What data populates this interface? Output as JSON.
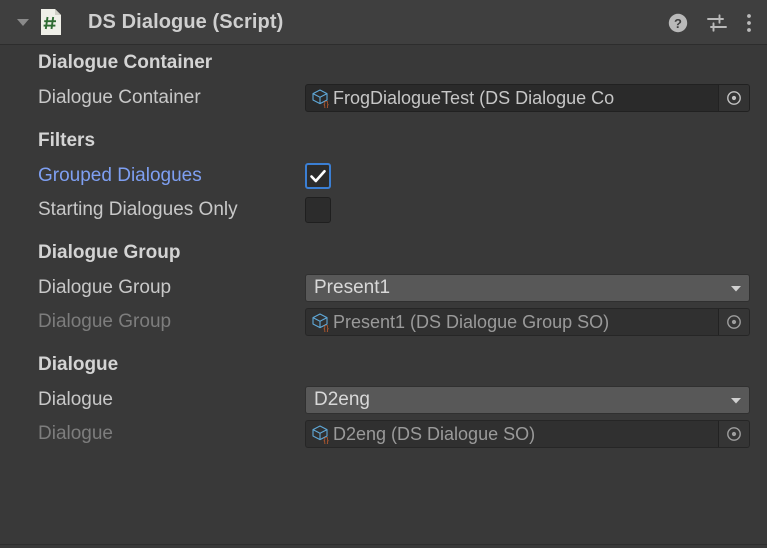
{
  "component": {
    "title": "DS Dialogue (Script)",
    "foldout_icon": "triangle-down-icon",
    "script_icon": "csharp-script-icon",
    "help_icon": "help-icon",
    "preset_icon": "preset-settings-icon",
    "menu_icon": "more-options-icon"
  },
  "colors": {
    "panel_bg": "#393939",
    "header_bg": "#3f3f3f",
    "accent_blue": "#7e9ff2",
    "checkbox_border": "#3b7fd4",
    "object_field_bg": "#2a2a2a",
    "dropdown_bg": "#585858",
    "label": "#c8c8c8",
    "label_disabled": "#7d7d7d"
  },
  "sections": [
    {
      "header": "Dialogue Container",
      "rows": [
        {
          "type": "object",
          "label": "Dialogue Container",
          "value": "FrogDialogueTest (DS Dialogue Co",
          "icon": "scriptable-object-icon",
          "picker_icon": "object-picker-icon",
          "disabled": false
        }
      ]
    },
    {
      "header": "Filters",
      "rows": [
        {
          "type": "checkbox",
          "label": "Grouped Dialogues",
          "checked": true,
          "label_highlight": true,
          "disabled": false
        },
        {
          "type": "checkbox",
          "label": "Starting Dialogues Only",
          "checked": false,
          "label_highlight": false,
          "disabled": false
        }
      ]
    },
    {
      "header": "Dialogue Group",
      "rows": [
        {
          "type": "dropdown",
          "label": "Dialogue Group",
          "value": "Present1",
          "arrow_icon": "chevron-down-icon",
          "disabled": false
        },
        {
          "type": "object",
          "label": "Dialogue Group",
          "value": "Present1 (DS Dialogue Group SO)",
          "icon": "scriptable-object-icon",
          "picker_icon": "object-picker-icon",
          "disabled": true
        }
      ]
    },
    {
      "header": "Dialogue",
      "rows": [
        {
          "type": "dropdown",
          "label": "Dialogue",
          "value": "D2eng",
          "arrow_icon": "chevron-down-icon",
          "disabled": false
        },
        {
          "type": "object",
          "label": "Dialogue",
          "value": "D2eng (DS Dialogue SO)",
          "icon": "scriptable-object-icon",
          "picker_icon": "object-picker-icon",
          "disabled": true
        }
      ]
    }
  ]
}
